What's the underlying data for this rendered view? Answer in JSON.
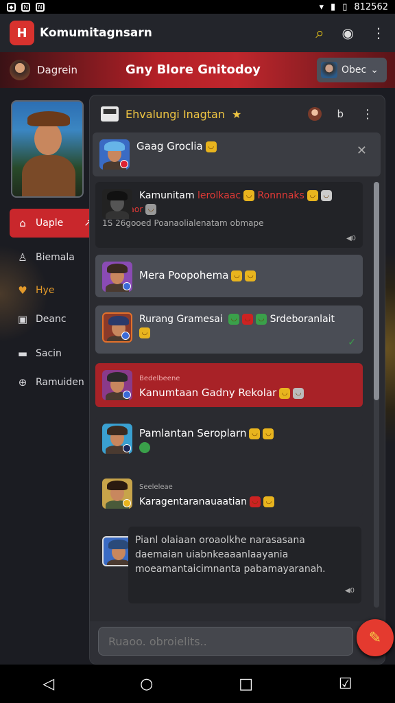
{
  "status": {
    "time": "812562"
  },
  "app": {
    "title": "Komumitagnsarn",
    "logo_text": "H"
  },
  "banner": {
    "user": "Dagrein",
    "title": "Gny Blore Gnitodoy",
    "button_label": "Obec"
  },
  "sidebar": {
    "items": [
      {
        "label": "Uaple",
        "icon": "home-icon",
        "active": true
      },
      {
        "label": "Biemala",
        "icon": "user-icon"
      },
      {
        "label": "Hye",
        "icon": "heart-icon",
        "gold": true
      },
      {
        "label": "Deanc",
        "icon": "box-icon"
      },
      {
        "label": "Sacin",
        "icon": "storage-icon"
      },
      {
        "label": "Ramuiden",
        "icon": "globe-icon"
      }
    ]
  },
  "panel": {
    "title": "Ehvalungi Inagtan",
    "header_text": "b",
    "cards": [
      {
        "name": "Gaag Groclia",
        "type": "dismissable"
      },
      {
        "name": "Kamunitam",
        "name_red": "lerolkaac",
        "name_red2": "Ronnnaks",
        "line2_red": "Rorraoaor",
        "preview": "1S 26gooed Poanaolialenatam obmape"
      },
      {
        "name": "Mera Poopohema"
      },
      {
        "name": "Rurang Gramesai",
        "suffix": "Srdeboranlait"
      },
      {
        "name": "Kanumtaan Gadny Rekolar",
        "small": "Bedelbeene",
        "highlight": true
      },
      {
        "name": "Pamlantan Seroplarn"
      },
      {
        "name": "Karagentaranauaatian",
        "small": "Seeleleae"
      },
      {
        "name": "",
        "preview": "Pianl olaiaan oroaolkhe narasasana daemaian uiabnkeaaanlaayania moeamantaicimnanta pabamayaranah."
      }
    ]
  },
  "composer": {
    "placeholder": "Ruaoo. obroielits.."
  }
}
